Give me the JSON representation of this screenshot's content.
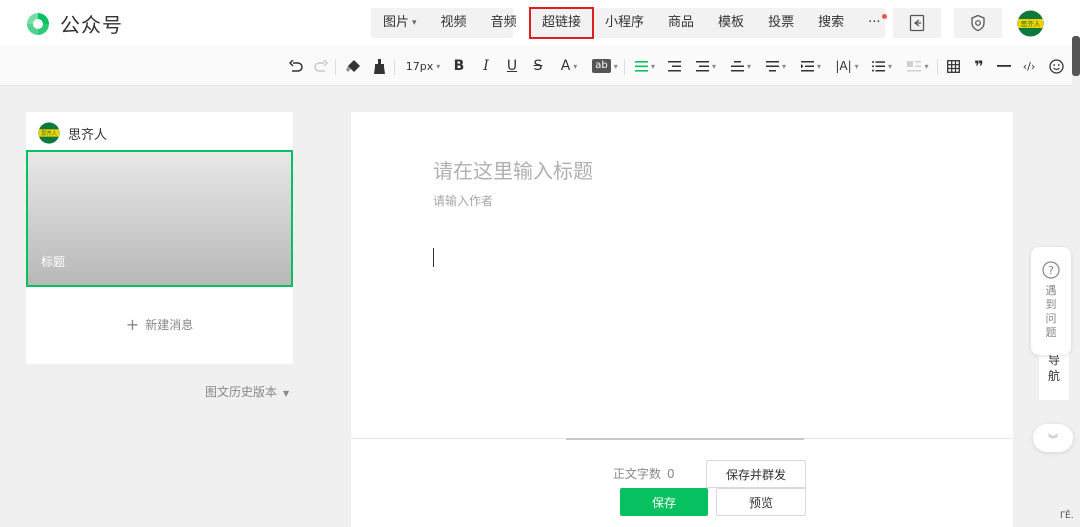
{
  "brand": {
    "name": "公众号",
    "color": "#07c160"
  },
  "insert_menu": {
    "group1": [
      {
        "label": "图片",
        "has_caret": true
      },
      {
        "label": "视频"
      },
      {
        "label": "音频"
      }
    ],
    "group2": [
      {
        "label": "超链接",
        "highlighted": true
      },
      {
        "label": "小程序"
      },
      {
        "label": "商品"
      },
      {
        "label": "模板"
      },
      {
        "label": "投票"
      },
      {
        "label": "搜索"
      },
      {
        "label": "···",
        "has_dot": true
      }
    ]
  },
  "toolbar": {
    "font_size": "17px",
    "bold": "B",
    "italic": "I",
    "underline": "U",
    "strikethrough": "S",
    "font_color": "A",
    "bg_color": "ab"
  },
  "account": {
    "name": "思齐人",
    "avatar_text": "思齐人"
  },
  "article_list": {
    "cover_title": "标题",
    "new_message": "新建消息",
    "history": "图文历史版本"
  },
  "editor": {
    "title_placeholder": "请在这里输入标题",
    "author_placeholder": "请输入作者"
  },
  "footer": {
    "word_count_label": "正文字数",
    "word_count": "0",
    "save_and_mass": "保存并群发",
    "save": "保存",
    "preview": "预览"
  },
  "float": {
    "help": "遇到问题",
    "nav": "导航"
  },
  "colors": {
    "accent": "#07c160",
    "highlight_border": "#e02020"
  }
}
